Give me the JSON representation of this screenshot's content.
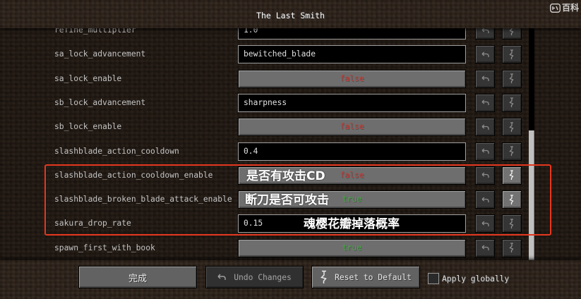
{
  "window": {
    "title": "The Last Smith"
  },
  "watermark": {
    "text": "百科"
  },
  "icons": {
    "undo": "undo-icon",
    "reset": "reset-icon",
    "watermark_logo": "baike-logo-icon"
  },
  "colors": {
    "false_text": "#c43b36",
    "true_text": "#3fae3f",
    "highlight": "#e5371f"
  },
  "entries": [
    {
      "label": "refine_multiplier",
      "value": "1.0",
      "reset_enabled": false
    },
    {
      "label": "sa_lock_advancement",
      "value": "bewitched_blade",
      "reset_enabled": false
    },
    {
      "label": "sa_lock_enable",
      "value": "false",
      "reset_enabled": false
    },
    {
      "label": "sb_lock_advancement",
      "value": "sharpness",
      "reset_enabled": false
    },
    {
      "label": "sb_lock_enable",
      "value": "false",
      "reset_enabled": false
    },
    {
      "label": "slashblade_action_cooldown",
      "value": "0.4",
      "reset_enabled": false
    },
    {
      "label": "slashblade_action_cooldown_enable",
      "value": "false",
      "reset_enabled": true
    },
    {
      "label": "slashblade_broken_blade_attack_enable",
      "value": "true",
      "reset_enabled": true
    },
    {
      "label": "sakura_drop_rate",
      "value": "0.15",
      "reset_enabled": false
    },
    {
      "label": "spawn_first_with_book",
      "value": "true",
      "reset_enabled": false
    }
  ],
  "annotations": {
    "notes": [
      "是否有攻击CD",
      "断刀是否可攻击",
      "魂樱花瓣掉落概率"
    ]
  },
  "scrollbar": {
    "scroll_position": 1.0,
    "visible_fraction": 0.56
  },
  "footer": {
    "done_label": "完成",
    "undo_label": "Undo Changes",
    "undo_enabled": false,
    "reset_label": "Reset to Default",
    "reset_enabled": true,
    "apply_globally_label": "Apply globally",
    "apply_globally_checked": false
  }
}
